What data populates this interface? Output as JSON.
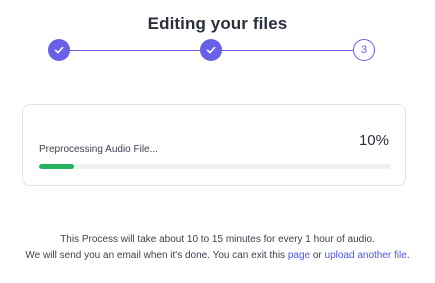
{
  "header": {
    "title": "Editing your files"
  },
  "stepper": {
    "steps": [
      {
        "status": "complete",
        "icon": "check-icon"
      },
      {
        "status": "complete",
        "icon": "check-icon"
      },
      {
        "status": "pending",
        "number": "3"
      }
    ],
    "accent_color": "#6a5fe7"
  },
  "progress": {
    "label": "Preprocessing Audio File...",
    "percent_text": "10%",
    "fraction": 0.1,
    "fill_color": "#23b35a"
  },
  "info": {
    "line1": "This Process will take about 10 to 15 minutes for every 1 hour of audio.",
    "line2_prefix": "We will send you an email when it's done. You can exit this ",
    "page_link": "page",
    "connector": " or ",
    "upload_link": "upload another file",
    "line2_suffix": "."
  }
}
